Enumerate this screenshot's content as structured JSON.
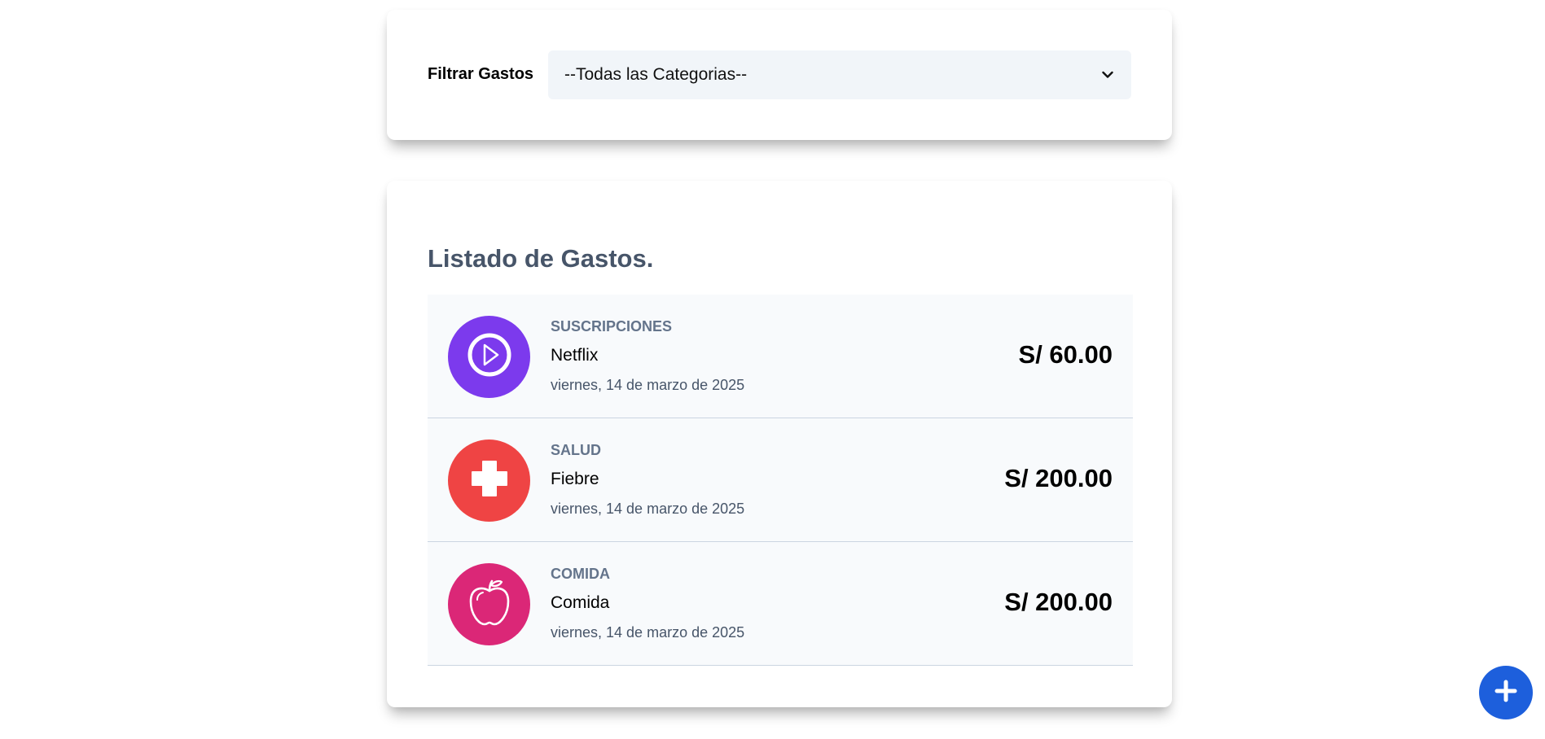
{
  "filter": {
    "label": "Filtrar Gastos",
    "selected": "--Todas las Categorias--"
  },
  "list": {
    "title": "Listado de Gastos.",
    "expenses": [
      {
        "category": "SUSCRIPCIONES",
        "name": "Netflix",
        "date": "viernes, 14 de marzo de 2025",
        "amount": "S/ 60.00",
        "icon": "play-icon",
        "color": "#7c3aed"
      },
      {
        "category": "SALUD",
        "name": "Fiebre",
        "date": "viernes, 14 de marzo de 2025",
        "amount": "S/ 200.00",
        "icon": "medical-cross-icon",
        "color": "#ef4444"
      },
      {
        "category": "COMIDA",
        "name": "Comida",
        "date": "viernes, 14 de marzo de 2025",
        "amount": "S/ 200.00",
        "icon": "apple-icon",
        "color": "#db2777"
      }
    ]
  },
  "fab": {
    "icon": "plus-icon",
    "color": "#1d5fdc"
  }
}
